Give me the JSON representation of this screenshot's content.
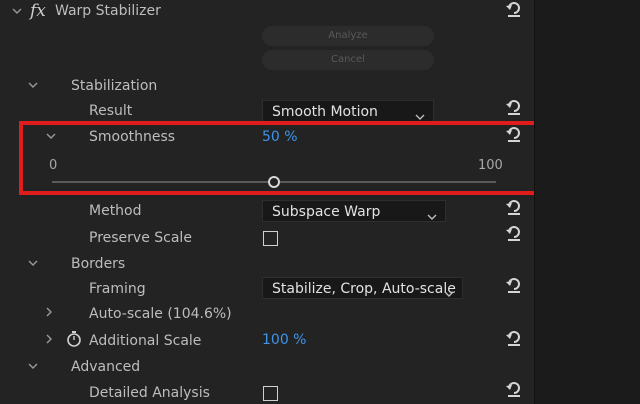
{
  "effect": {
    "fx_symbol": "fx",
    "name": "Warp Stabilizer",
    "analyze_label": "Analyze",
    "cancel_label": "Cancel"
  },
  "stabilization": {
    "section_label": "Stabilization",
    "result_label": "Result",
    "result_value": "Smooth Motion",
    "smoothness_label": "Smoothness",
    "smoothness_value": "50 %",
    "slider_min": "0",
    "slider_max": "100",
    "slider_fraction": 0.5,
    "method_label": "Method",
    "method_value": "Subspace Warp",
    "preserve_scale_label": "Preserve Scale",
    "preserve_scale_checked": false
  },
  "borders": {
    "section_label": "Borders",
    "framing_label": "Framing",
    "framing_value": "Stabilize, Crop, Auto-scale",
    "autoscale_label": "Auto-scale (104.6%)",
    "additional_scale_label": "Additional Scale",
    "additional_scale_value": "100 %"
  },
  "advanced": {
    "section_label": "Advanced",
    "detailed_analysis_label": "Detailed Analysis",
    "detailed_analysis_checked": false
  },
  "colors": {
    "accent_blue": "#3d94ea",
    "highlight_red": "#e01d1d",
    "panel_bg": "#232323"
  }
}
